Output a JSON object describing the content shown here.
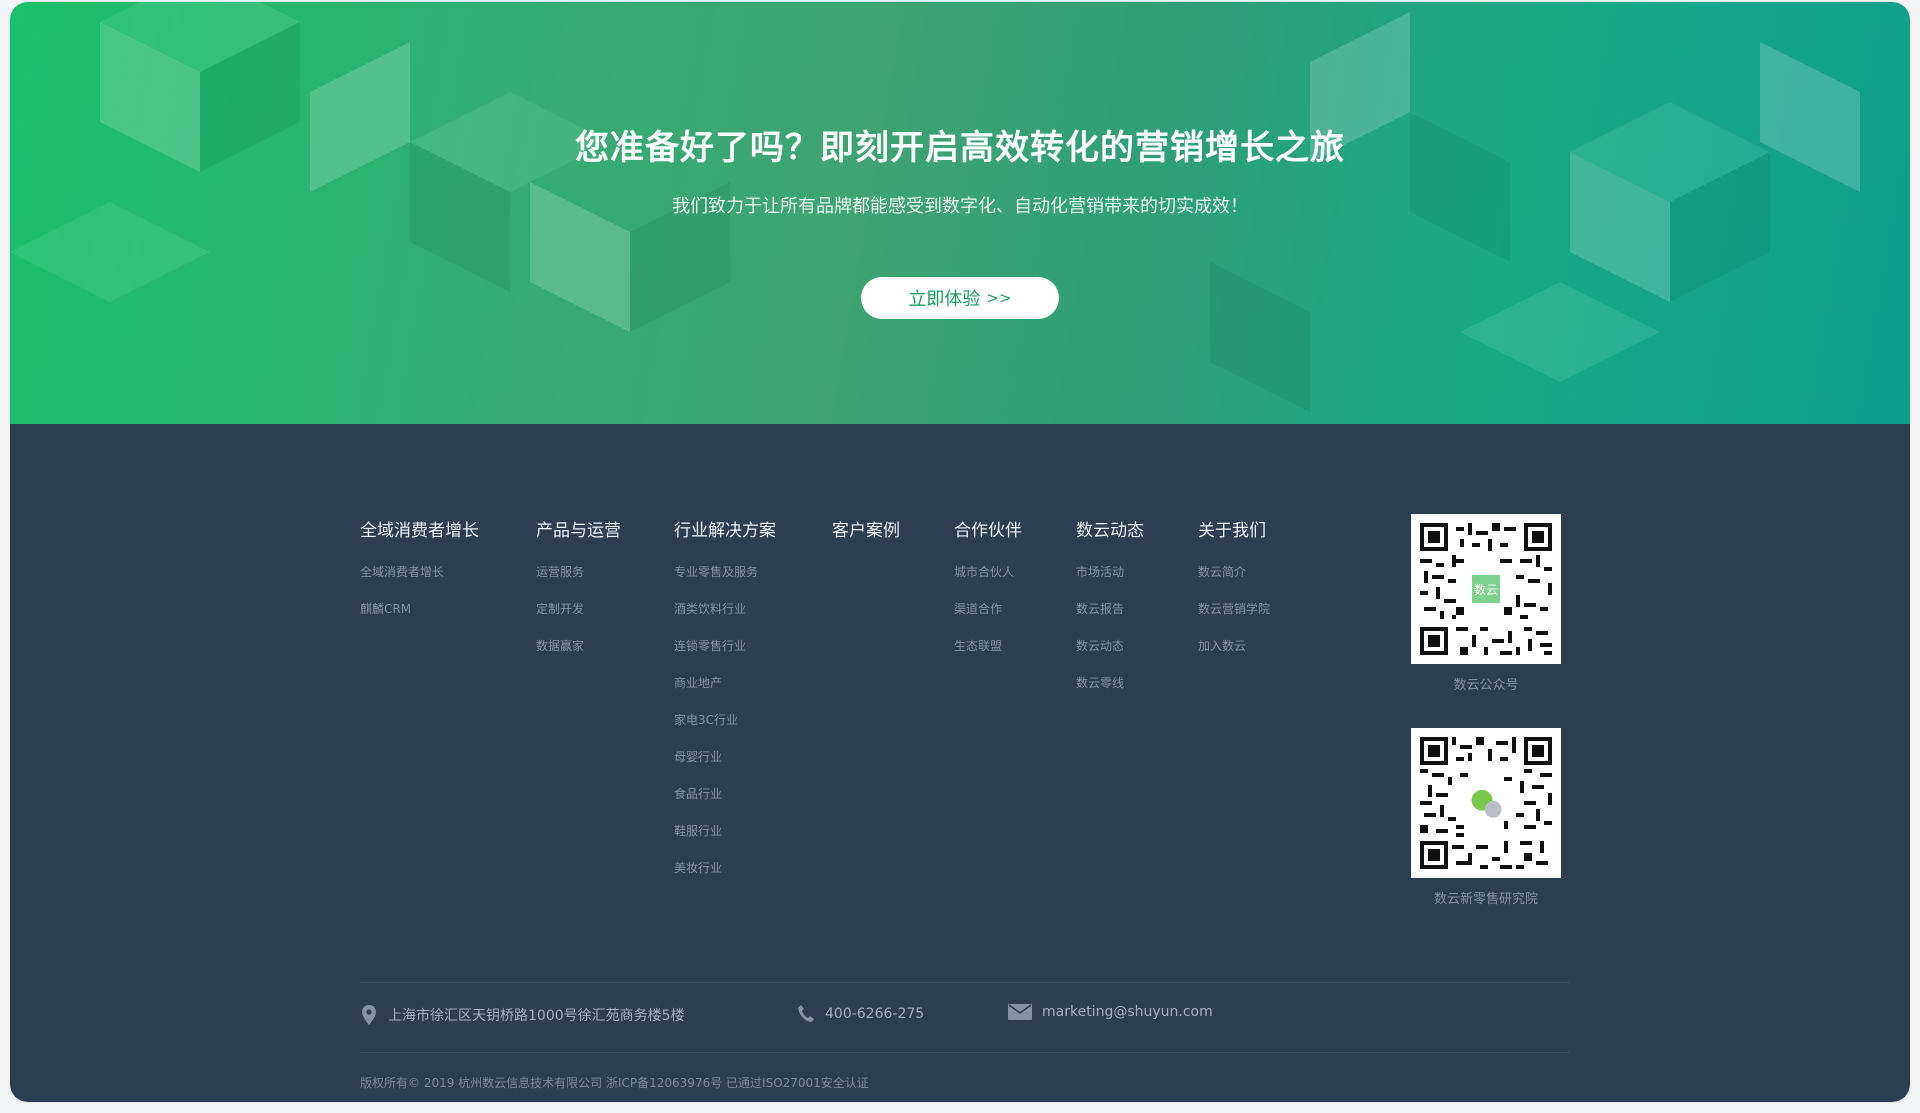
{
  "hero": {
    "title": "您准备好了吗？即刻开启高效转化的营销增长之旅",
    "subtitle": "我们致力于让所有品牌都能感受到数字化、自动化营销带来的切实成效！",
    "cta_label": "立即体验",
    "cta_icon": "double-chevron-right-icon",
    "colors": {
      "gradient_start": "#19c06b",
      "gradient_end": "#0f9e8d",
      "cta_text": "#1a9e62"
    }
  },
  "footer": {
    "background": "#2d3e52",
    "columns": [
      {
        "title": "全域消费者增长",
        "links": [
          "全域消费者增长",
          "麒麟CRM"
        ]
      },
      {
        "title": "产品与运营",
        "links": [
          "运营服务",
          "定制开发",
          "数据赢家"
        ]
      },
      {
        "title": "行业解决方案",
        "links": [
          "专业零售及服务",
          "酒类饮料行业",
          "连锁零售行业",
          "商业地产",
          "家电3C行业",
          "母婴行业",
          "食品行业",
          "鞋服行业",
          "美妆行业"
        ]
      },
      {
        "title": "客户案例",
        "links": []
      },
      {
        "title": "合作伙伴",
        "links": [
          "城市合伙人",
          "渠道合作",
          "生态联盟"
        ]
      },
      {
        "title": "数云动态",
        "links": [
          "市场活动",
          "数云报告",
          "数云动态",
          "数云零线"
        ]
      },
      {
        "title": "关于我们",
        "links": [
          "数云简介",
          "数云营销学院",
          "加入数云"
        ]
      }
    ],
    "qr_codes": [
      {
        "caption": "数云公众号",
        "center_icon": "shuyun-logo-icon"
      },
      {
        "caption": "数云新零售研究院",
        "center_icon": "wechat-icon"
      }
    ],
    "contact": {
      "address": "上海市徐汇区天钥桥路1000号徐汇苑商务楼5楼",
      "phone": "400-6266-275",
      "email": "marketing@shuyun.com"
    },
    "copyright": "版权所有© 2019 杭州数云信息技术有限公司   浙ICP备12063976号 已通过ISO27001安全认证"
  }
}
